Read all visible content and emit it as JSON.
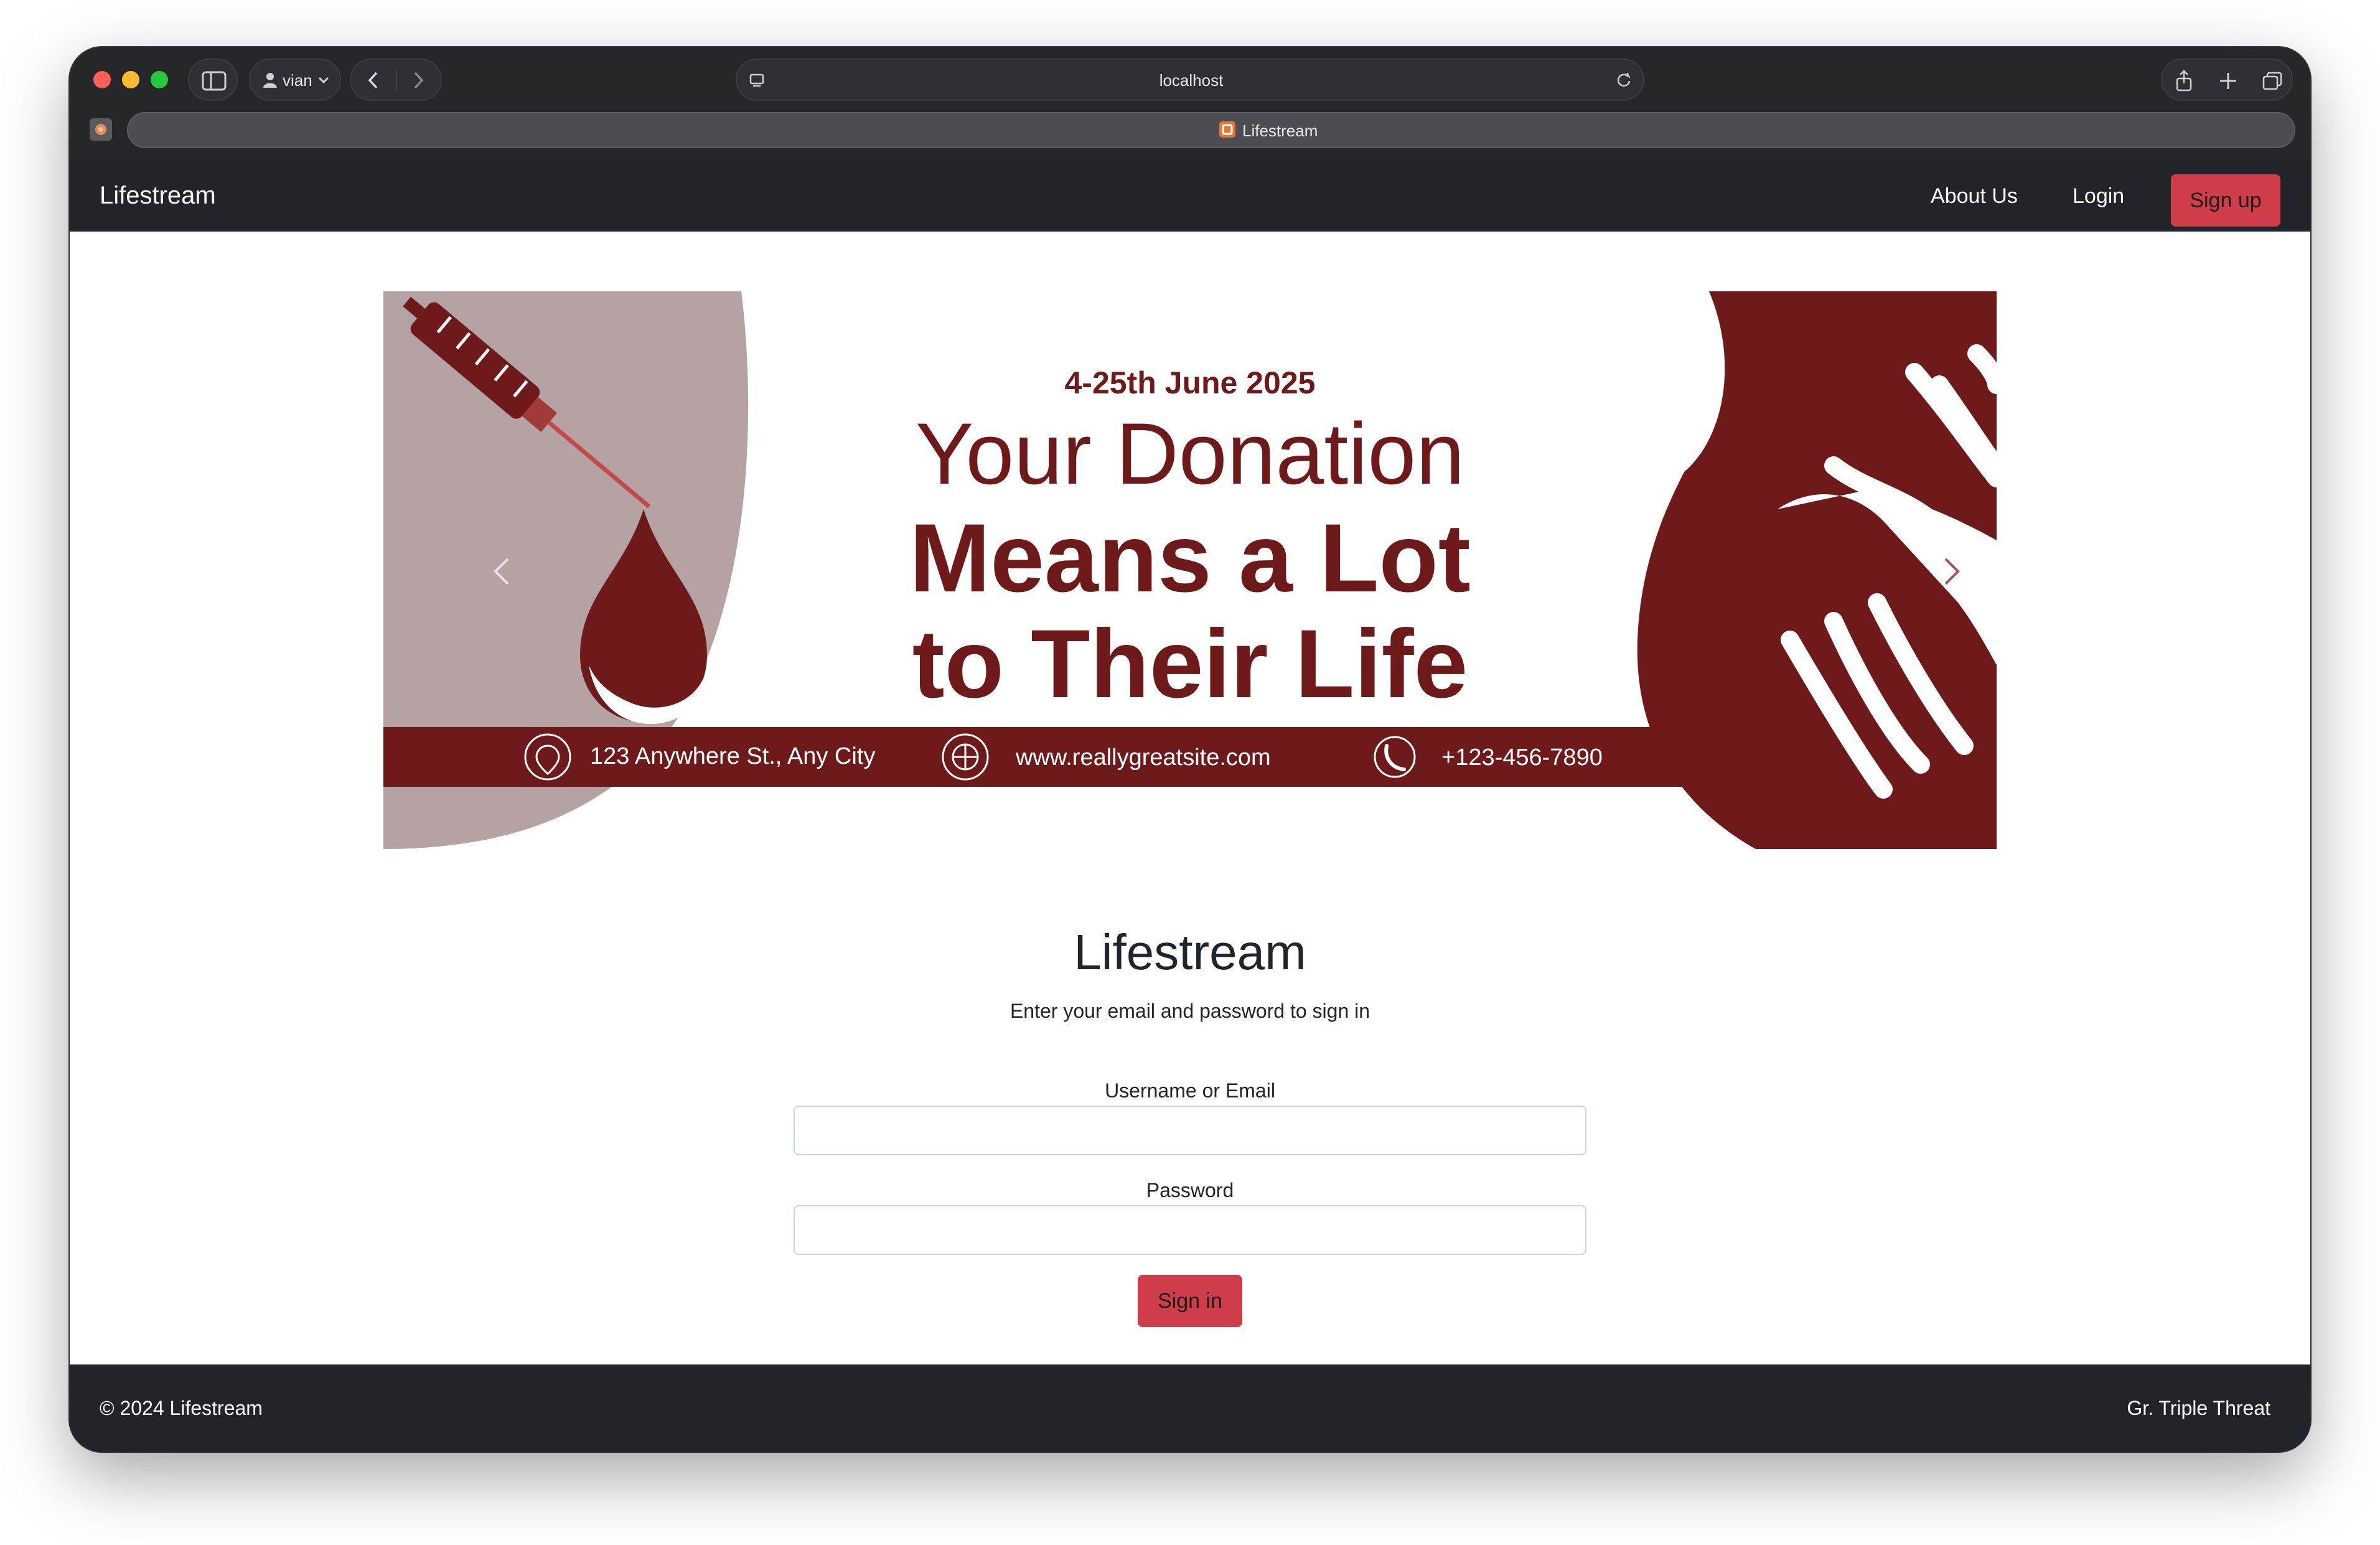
{
  "browser": {
    "profile_label": "vian",
    "address": "localhost",
    "tab_title": "Lifestream"
  },
  "navbar": {
    "brand": "Lifestream",
    "about_label": "About Us",
    "login_label": "Login",
    "signup_label": "Sign up"
  },
  "banner": {
    "date": "4-25th June 2025",
    "headline_1": "Your Donation",
    "headline_2": "Means a Lot",
    "headline_3": "to Their Life",
    "address": "123 Anywhere St., Any City",
    "website": "www.reallygreatsite.com",
    "phone": "+123-456-7890",
    "colors": {
      "dark_red": "#6e1a1a",
      "mauve": "#b5a3a4",
      "red": "#c44a4a"
    }
  },
  "form": {
    "title": "Lifestream",
    "subtitle": "Enter your email and password to sign in",
    "username_label": "Username or Email",
    "password_label": "Password",
    "submit_label": "Sign in"
  },
  "footer": {
    "copyright": "© 2024 Lifestream",
    "credit": "Gr. Triple Threat"
  },
  "colors": {
    "accent": "#cf3d4a",
    "dark": "#212529"
  }
}
